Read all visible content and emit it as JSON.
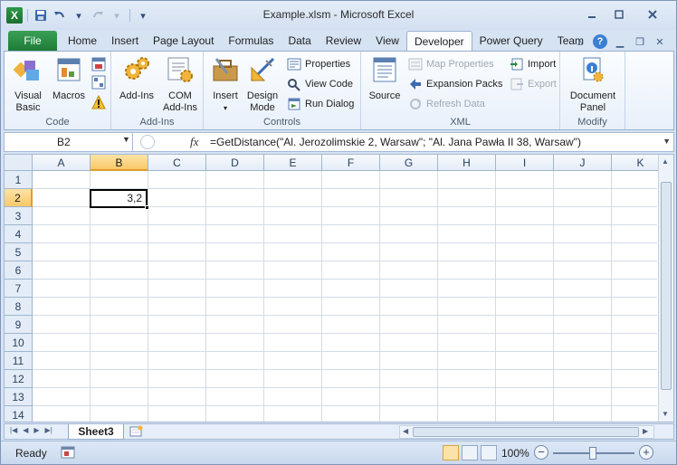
{
  "app": {
    "title": "Example.xlsm  -  Microsoft Excel"
  },
  "qat": {
    "logo": "X",
    "save_icon": "save-icon",
    "undo_icon": "undo-icon",
    "redo_icon": "redo-icon",
    "customize_icon": "customize-icon"
  },
  "tabs": [
    {
      "label": "File"
    },
    {
      "label": "Home"
    },
    {
      "label": "Insert"
    },
    {
      "label": "Page Layout"
    },
    {
      "label": "Formulas"
    },
    {
      "label": "Data"
    },
    {
      "label": "Review"
    },
    {
      "label": "View"
    },
    {
      "label": "Developer"
    },
    {
      "label": "Power Query"
    },
    {
      "label": "Team"
    }
  ],
  "active_tab": "Developer",
  "ribbon": {
    "code": {
      "label": "Code",
      "visual_basic": "Visual Basic",
      "visual_basic_l1": "Visual",
      "visual_basic_l2": "Basic",
      "macros": "Macros"
    },
    "addins": {
      "label": "Add-Ins",
      "addins": "Add-Ins",
      "com_l1": "COM",
      "com_l2": "Add-Ins"
    },
    "controls": {
      "label": "Controls",
      "insert": "Insert",
      "design_l1": "Design",
      "design_l2": "Mode",
      "properties": "Properties",
      "view_code": "View Code",
      "run_dialog": "Run Dialog"
    },
    "xml": {
      "label": "XML",
      "source": "Source",
      "map_properties": "Map Properties",
      "expansion_packs": "Expansion Packs",
      "refresh_data": "Refresh Data",
      "import": "Import",
      "export": "Export"
    },
    "modify": {
      "label": "Modify",
      "doc_l1": "Document",
      "doc_l2": "Panel"
    }
  },
  "formula_bar": {
    "name_box": "B2",
    "fx": "fx",
    "formula": "=GetDistance(\"Al. Jerozolimskie 2, Warsaw\"; \"Al. Jana Pawła II 38, Warsaw\")"
  },
  "grid": {
    "columns": [
      "A",
      "B",
      "C",
      "D",
      "E",
      "F",
      "G",
      "H",
      "I",
      "J",
      "K"
    ],
    "rows": [
      "1",
      "2",
      "3",
      "4",
      "5",
      "6",
      "7",
      "8",
      "9",
      "10",
      "11",
      "12",
      "13",
      "14"
    ],
    "selected_column": "B",
    "selected_row": "2",
    "cell_B2": "3,2"
  },
  "sheets": [
    {
      "label": "Sheet3"
    }
  ],
  "status": {
    "ready": "Ready",
    "zoom": "100%",
    "zoom_minus": "−",
    "zoom_plus": "+"
  }
}
